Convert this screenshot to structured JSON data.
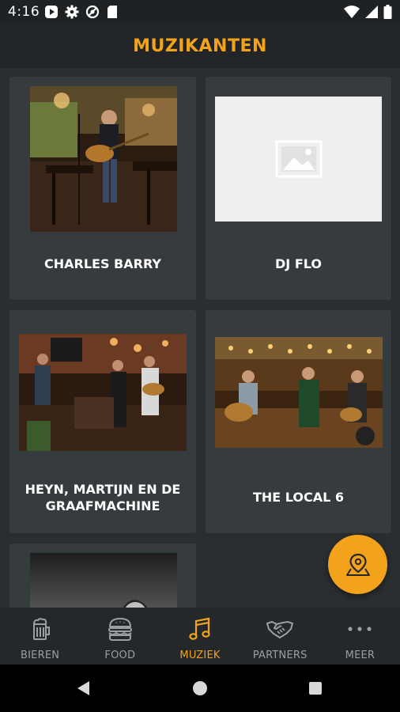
{
  "status_bar": {
    "time": "4:16",
    "left_icons": [
      "play-icon",
      "gear-icon",
      "vpn-icon",
      "sd-card-icon"
    ],
    "right_icons": [
      "wifi-icon",
      "signal-icon",
      "battery-icon"
    ]
  },
  "header": {
    "title": "MUZIKANTEN"
  },
  "musicians": [
    {
      "name": "CHARLES BARRY",
      "image": "photo"
    },
    {
      "name": "DJ FLO",
      "image": "placeholder"
    },
    {
      "name": "HEYN, MARTIJN EN DE GRAAFMACHINE",
      "image": "photo"
    },
    {
      "name": "THE LOCAL 6",
      "image": "photo"
    },
    {
      "name": "",
      "image": "photo"
    }
  ],
  "fab": {
    "icon": "map-pin-icon"
  },
  "bottom_nav": {
    "items": [
      {
        "label": "BIEREN",
        "icon": "beer-mug-icon",
        "active": false
      },
      {
        "label": "FOOD",
        "icon": "burger-icon",
        "active": false
      },
      {
        "label": "MUZIEK",
        "icon": "music-note-icon",
        "active": true
      },
      {
        "label": "PARTNERS",
        "icon": "handshake-icon",
        "active": false
      },
      {
        "label": "MEER",
        "icon": "more-dots-icon",
        "active": false
      }
    ]
  },
  "system_nav": {
    "icons": [
      "back-icon",
      "home-icon",
      "recents-icon"
    ]
  },
  "colors": {
    "accent": "#f2a31b",
    "background": "#2a2e30",
    "card": "#363b3e"
  }
}
